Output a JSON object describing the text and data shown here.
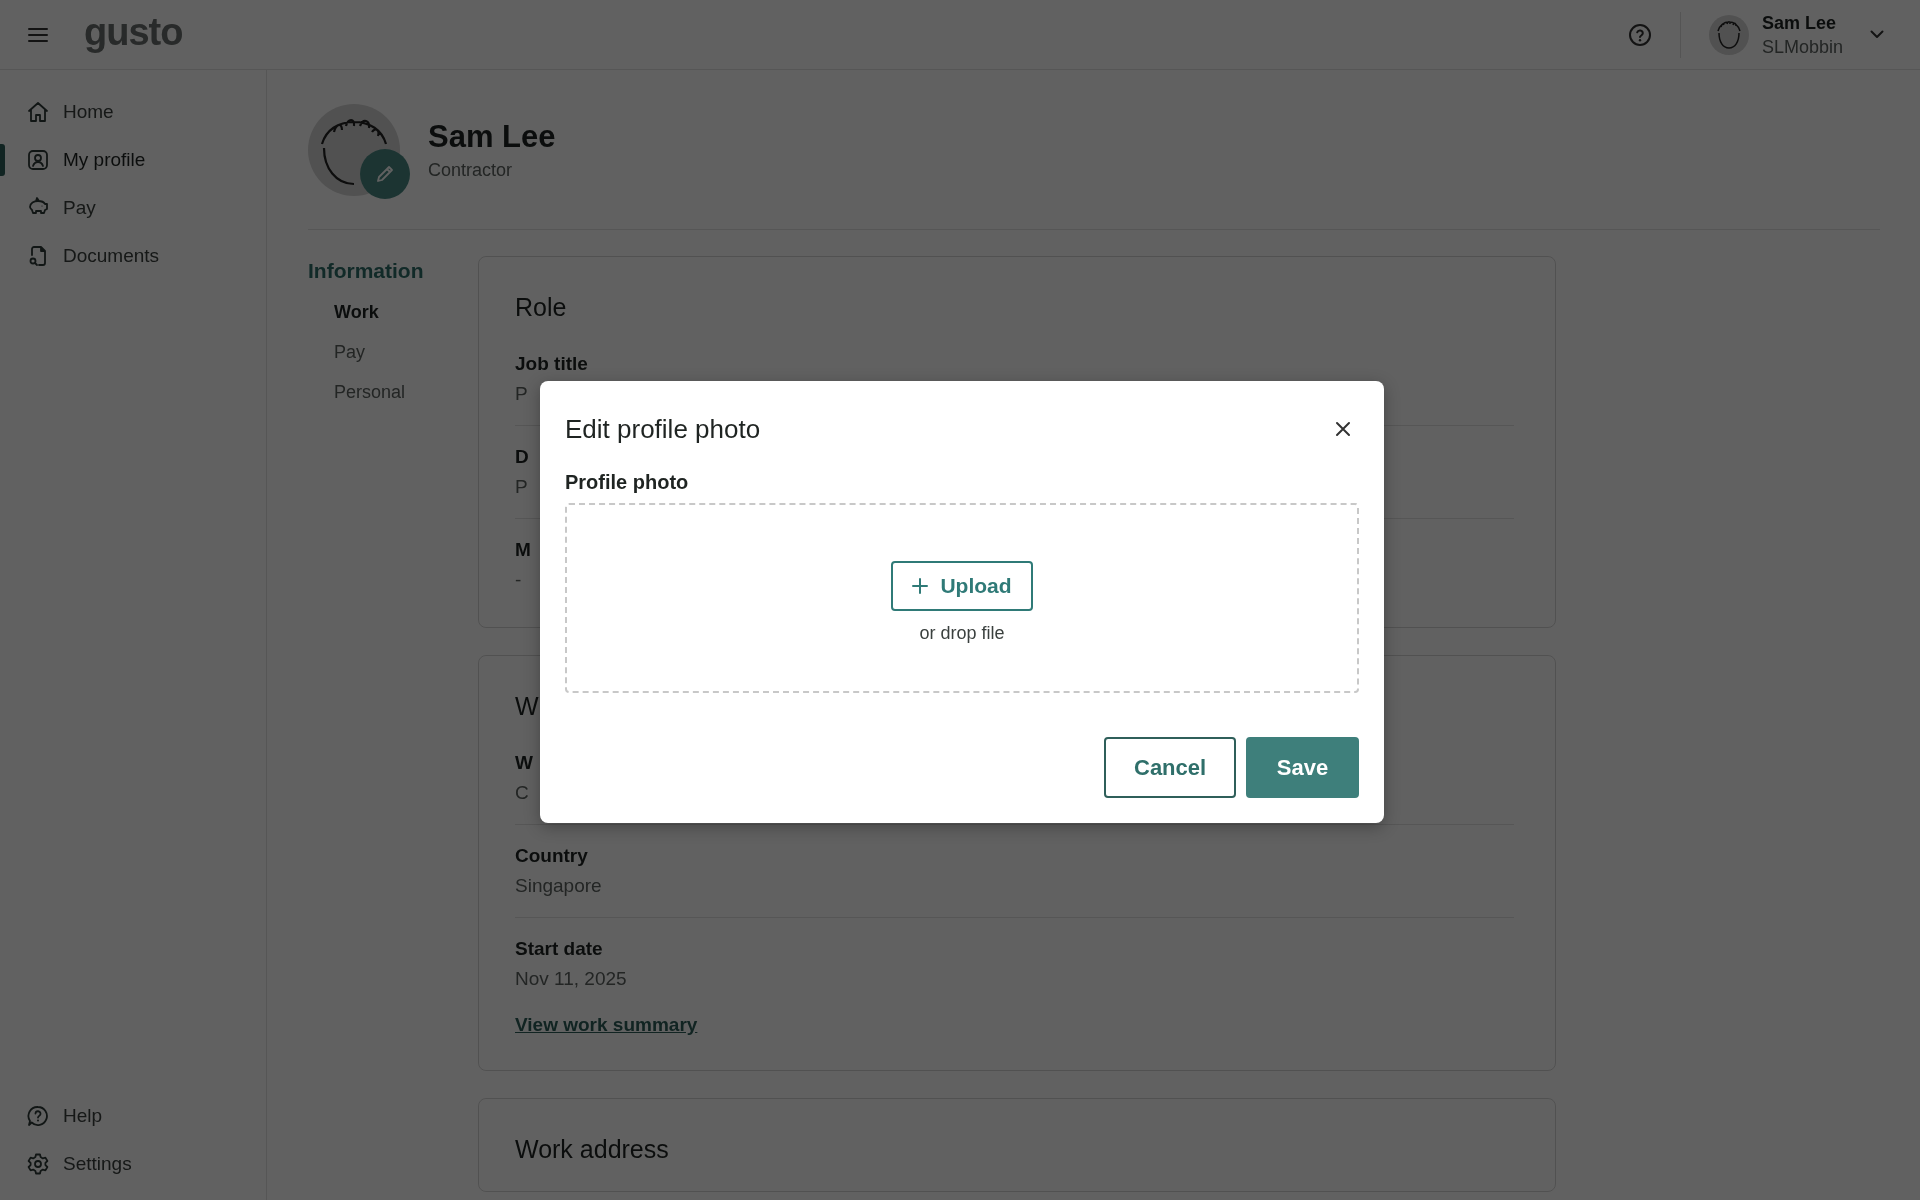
{
  "top_bar": {
    "logo": "gusto",
    "user": {
      "name": "Sam Lee",
      "username": "SLMobbin"
    }
  },
  "sidebar": {
    "items": [
      {
        "label": "Home",
        "selected": false
      },
      {
        "label": "My profile",
        "selected": true
      },
      {
        "label": "Pay",
        "selected": false
      },
      {
        "label": "Documents",
        "selected": false
      }
    ],
    "footer_items": [
      {
        "label": "Help"
      },
      {
        "label": "Settings"
      }
    ]
  },
  "profile": {
    "name": "Sam Lee",
    "role": "Contractor"
  },
  "section_nav": {
    "title": "Information",
    "items": [
      {
        "label": "Work",
        "selected": true
      },
      {
        "label": "Pay",
        "selected": false
      },
      {
        "label": "Personal",
        "selected": false
      }
    ]
  },
  "cards": [
    {
      "title": "Role",
      "fields": [
        {
          "label": "Job title",
          "value": "P"
        },
        {
          "label": "D",
          "value": "P"
        },
        {
          "label": "M",
          "value": "-"
        }
      ]
    },
    {
      "title": "W",
      "fields": [
        {
          "label": "W",
          "value": "C"
        },
        {
          "label": "Country",
          "value": "Singapore"
        },
        {
          "label": "Start date",
          "value": "Nov 11, 2025"
        }
      ],
      "link": "View work summary"
    },
    {
      "title": "Work address"
    }
  ],
  "dialog": {
    "title": "Edit profile photo",
    "field_label": "Profile photo",
    "upload_button": "Upload",
    "drop_hint": "or drop file",
    "buttons": [
      {
        "label": "Cancel",
        "kind": "secondary"
      },
      {
        "label": "Save",
        "kind": "primary"
      }
    ]
  }
}
